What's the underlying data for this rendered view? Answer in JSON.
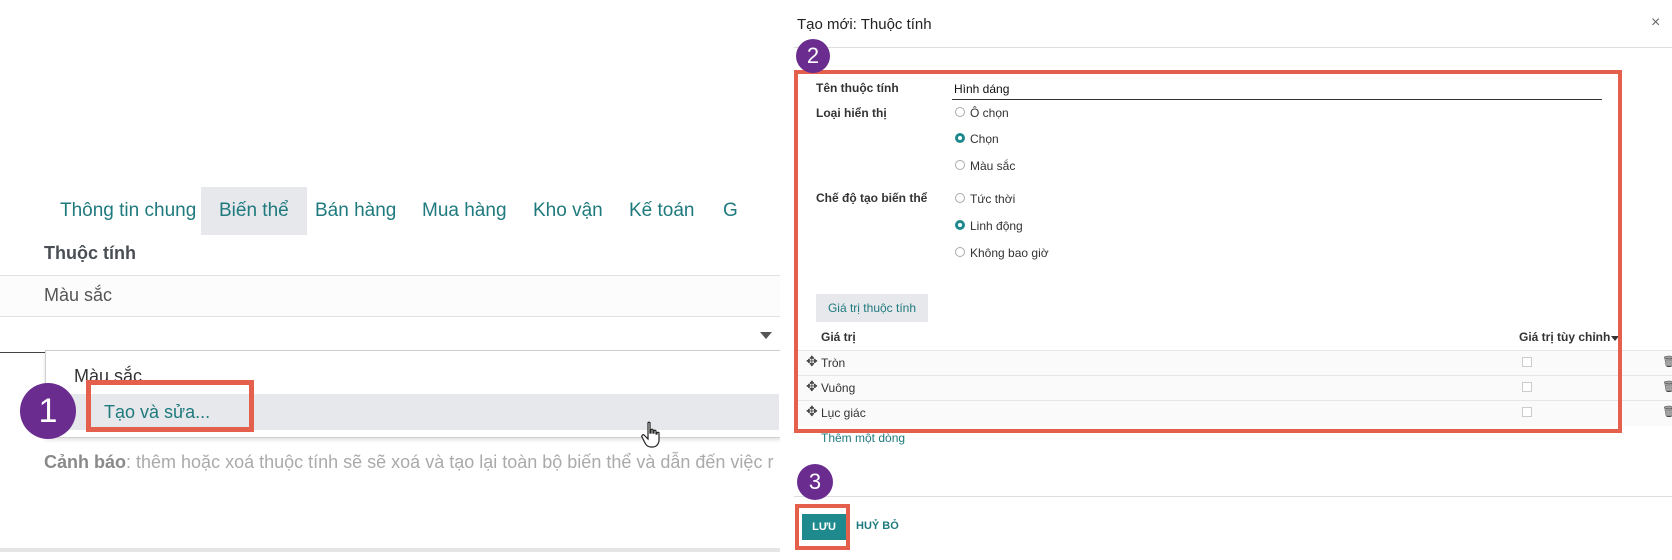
{
  "left": {
    "tabs": [
      "Thông tin chung",
      "Biến thể",
      "Bán hàng",
      "Mua hàng",
      "Kho vận",
      "Kế toán",
      "G"
    ],
    "attribute_header": "Thuộc tính",
    "attribute_row": "Màu sắc",
    "dropdown": {
      "item1": "Màu sắc",
      "item2": "Tạo và sửa..."
    },
    "warning_label": "Cảnh báo",
    "warning_text": ": thêm hoặc xoá thuộc tính sẽ sẽ xoá và tạo lại toàn bộ biến thể và dẫn đến việc r",
    "step_badge": "1"
  },
  "dialog": {
    "title": "Tạo mới: Thuộc tính",
    "close": "×",
    "step_badge": "2",
    "name_label": "Tên thuộc tính",
    "name_value": "Hình dáng",
    "display_label": "Loại hiển thị",
    "display_options": [
      "Ô chọn",
      "Chọn",
      "Màu sắc"
    ],
    "display_selected": 1,
    "mode_label": "Chế độ tạo biến thể",
    "mode_options": [
      "Tức thời",
      "Linh động",
      "Không bao giờ"
    ],
    "mode_selected": 1,
    "values_tab": "Giá trị thuộc tính",
    "col_value": "Giá trị",
    "col_custom": "Giá trị tùy chỉnh",
    "rows": [
      "Tròn",
      "Vuông",
      "Lục giác"
    ],
    "add_line": "Thêm một dòng",
    "footer_badge": "3",
    "save": "LƯU",
    "cancel": "HUỶ BỎ"
  },
  "colors": {
    "accent": "#1f8a8e",
    "highlight": "#e4604c",
    "badge": "#6b2c8f"
  },
  "icons": [
    "close-icon",
    "drag-handle-icon",
    "trash-icon",
    "hand-cursor-icon",
    "dropdown-caret-icon"
  ]
}
